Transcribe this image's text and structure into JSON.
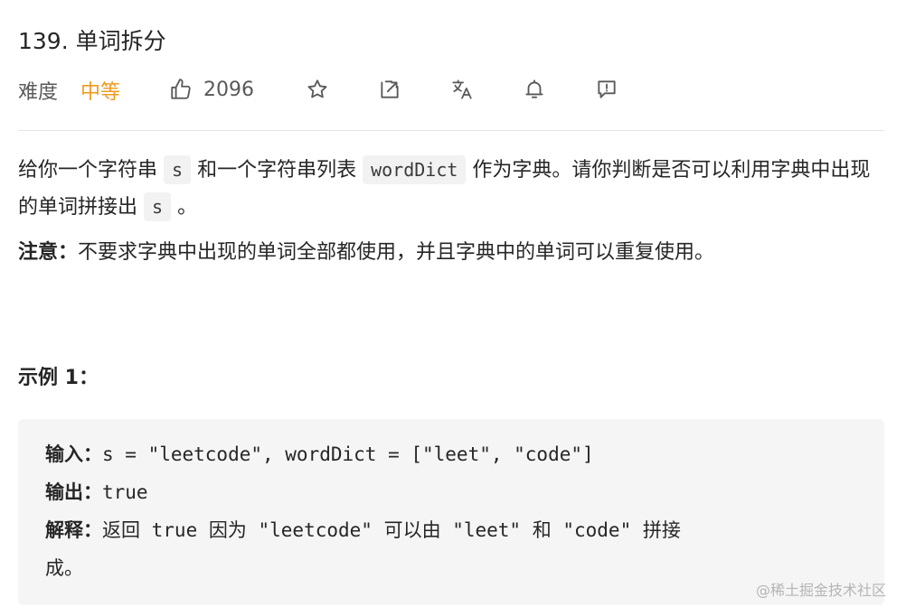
{
  "problem": {
    "title": "139. 单词拆分",
    "difficulty_label": "难度",
    "difficulty_value": "中等",
    "like_count": "2096"
  },
  "toolbar": {
    "icons": [
      "thumbs-up-icon",
      "star-icon",
      "share-icon",
      "translate-icon",
      "bell-icon",
      "feedback-icon"
    ]
  },
  "description": {
    "p1_part1": "给你一个字符串",
    "p1_code1": "s",
    "p1_part2": "和一个字符串列表",
    "p1_code2": "wordDict",
    "p1_part3": "作为字典。请你判断是否可以利用字典中出现的单词拼接出",
    "p1_code3": "s",
    "p1_part4": "。",
    "note_label": "注意：",
    "note_text": "不要求字典中出现的单词全部都使用，并且字典中的单词可以重复使用。"
  },
  "example": {
    "title": "示例 1：",
    "input_label": "输入：",
    "input_value": "s = \"leetcode\", wordDict = [\"leet\", \"code\"]",
    "output_label": "输出：",
    "output_value": "true",
    "explain_label": "解释：",
    "explain_value": "返回 true 因为 \"leetcode\" 可以由 \"leet\" 和 \"code\" 拼接",
    "explain_value_cont": "成。"
  },
  "watermark": "@稀土掘金技术社区",
  "colors": {
    "difficulty_medium": "#ef9a1f",
    "code_bg": "#f2f2f2",
    "example_bg": "#f5f5f5"
  }
}
